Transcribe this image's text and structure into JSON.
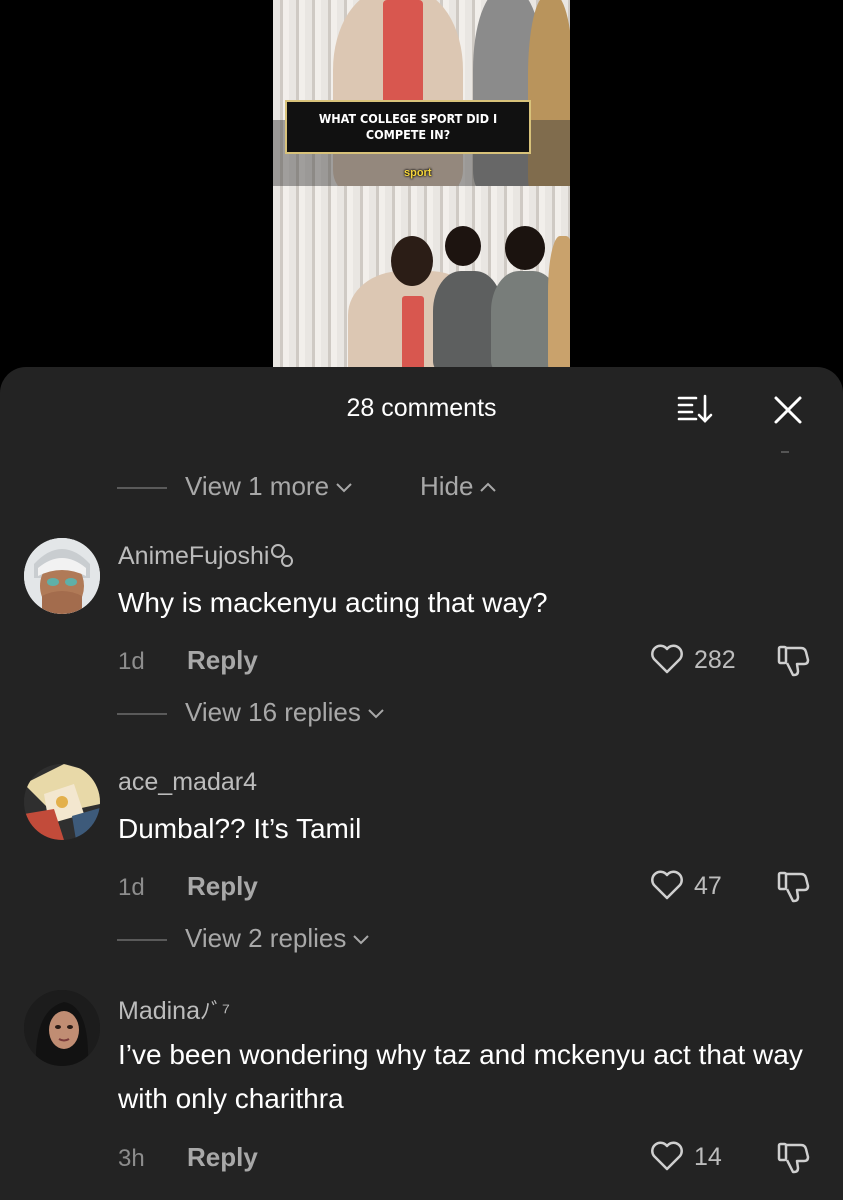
{
  "video": {
    "caption": "WHAT COLLEGE SPORT DID I COMPETE IN?",
    "subtitle": "sport"
  },
  "sheet": {
    "title": "28 comments",
    "sort_icon": "sort-icon",
    "close_icon": "close-icon"
  },
  "thread_controls": {
    "view_more": "View 1 more",
    "hide": "Hide"
  },
  "comments": [
    {
      "username": "AnimeFujoshi",
      "text": "Why is mackenyu acting that way?",
      "time": "1d",
      "reply_label": "Reply",
      "likes": "282",
      "view_replies": "View 16 replies"
    },
    {
      "username": "ace_madar4",
      "text": "Dumbal?? It’s Tamil",
      "time": "1d",
      "reply_label": "Reply",
      "likes": "47",
      "view_replies": "View 2 replies"
    },
    {
      "username": "Madina",
      "username_suffix": "ﾉﾞ⁷",
      "text": "I’ve been wondering why taz and mckenyu act that way with only charithra",
      "time": "3h",
      "reply_label": "Reply",
      "likes": "14"
    }
  ],
  "colors": {
    "sheet_bg": "#232323",
    "secondary_text": "#a8a8a8",
    "caption_border": "#d8c27a",
    "subtitle_text": "#f5d53b"
  }
}
